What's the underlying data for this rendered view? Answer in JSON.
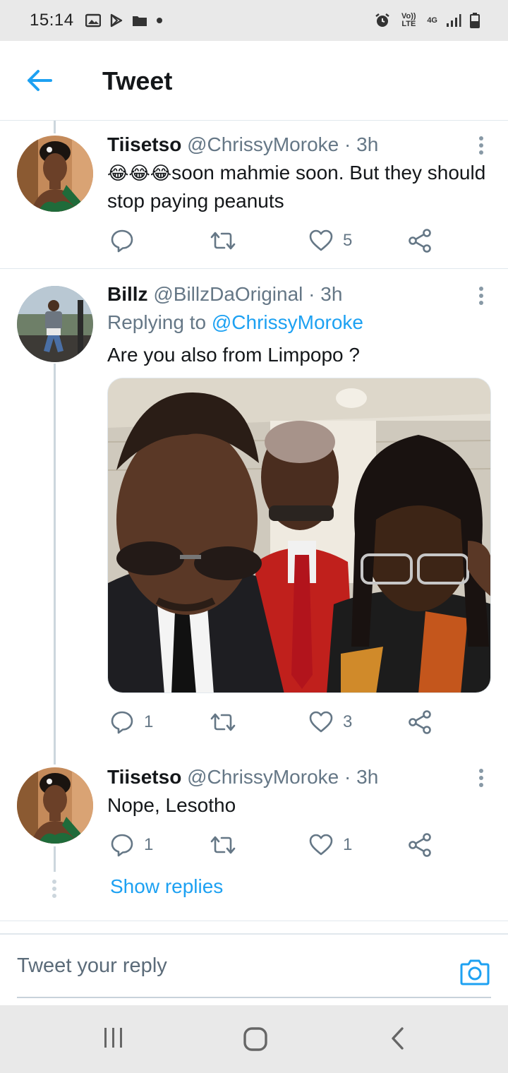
{
  "status_bar": {
    "time": "15:14",
    "signal_text_1": "Vo)) LTE",
    "signal_text_2": "4G"
  },
  "header": {
    "title": "Tweet"
  },
  "tweets": [
    {
      "name": "Tiisetso",
      "handle": "@ChrissyMoroke",
      "separator": "·",
      "time": "3h",
      "emoji": "😂😂😂",
      "text": "soon mahmie soon. But they should stop paying peanuts",
      "reply_count": "",
      "like_count": "5"
    },
    {
      "name": "Billz",
      "handle": "@BillzDaOriginal",
      "separator": "·",
      "time": "3h",
      "replying_prefix": "Replying to",
      "replying_to": "@ChrissyMoroke",
      "text": "Are you also from Limpopo ?",
      "reply_count": "1",
      "like_count": "3"
    },
    {
      "name": "Tiisetso",
      "handle": "@ChrissyMoroke",
      "separator": "·",
      "time": "3h",
      "text": "Nope, Lesotho",
      "reply_count": "1",
      "like_count": "1"
    }
  ],
  "show_replies": "Show replies",
  "reply_bar": {
    "placeholder": "Tweet your reply"
  },
  "colors": {
    "accent": "#1da1f2",
    "text": "#14171a",
    "muted": "#657786"
  },
  "icons": {
    "back": "arrow-left-icon",
    "reply": "comment-icon",
    "retweet": "retweet-icon",
    "like": "heart-icon",
    "share": "share-icon",
    "camera": "camera-icon"
  }
}
